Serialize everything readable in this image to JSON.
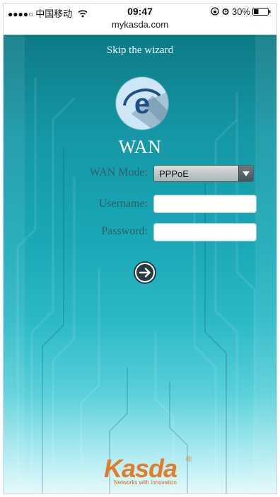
{
  "status_bar": {
    "signal": "●●●●○",
    "carrier": "中国移动",
    "time": "09:47",
    "battery": "30%"
  },
  "browser": {
    "url": "mykasda.com"
  },
  "wizard": {
    "skip_label": "Skip the wizard",
    "title": "WAN",
    "wan_mode_label": "WAN Mode:",
    "wan_mode_value": "PPPoE",
    "username_label": "Username:",
    "username_value": "",
    "password_label": "Password:",
    "password_value": ""
  },
  "brand": {
    "name": "Kasda",
    "registered": "®",
    "tagline": "Networks with Innovation"
  },
  "icons": {
    "logo": "internet-explorer-icon",
    "next": "arrow-right-circle-icon",
    "wifi": "wifi-icon",
    "battery": "battery-icon"
  },
  "colors": {
    "accent_teal": "#1597a6",
    "brand_orange": "#e07c2a",
    "label_color": "#2d5f66"
  }
}
